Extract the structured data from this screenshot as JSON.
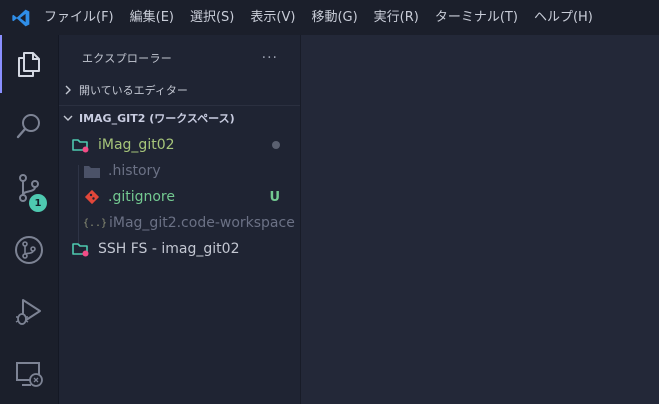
{
  "menu": {
    "logo_icon": "vscode-logo-icon",
    "items": [
      "ファイル(F)",
      "編集(E)",
      "選択(S)",
      "表示(V)",
      "移動(G)",
      "実行(R)",
      "ターミナル(T)",
      "ヘルプ(H)"
    ]
  },
  "activity": {
    "icons": [
      "explorer-icon",
      "search-icon",
      "source-control-icon",
      "git-graph-icon",
      "run-debug-icon",
      "remote-explorer-icon"
    ],
    "scm_badge": "1"
  },
  "sidebar": {
    "title": "エクスプローラー",
    "more": "···",
    "open_editors": "開いているエディター",
    "workspace": "IMAG_GIT2 (ワークスペース)",
    "items": [
      {
        "label": "iMag_git02",
        "color": "#a6c57a",
        "icon": "remote-folder-icon"
      },
      {
        "label": ".history",
        "color": "#6b7185",
        "icon": "folder-icon"
      },
      {
        "label": ".gitignore",
        "color": "#73c991",
        "icon": "git-file-icon",
        "badge": "U"
      },
      {
        "label": "iMag_git2.code-workspace",
        "color": "#6b7185",
        "icon": "json-braces-icon"
      },
      {
        "label": "SSH FS - imag_git02",
        "color": "#c3c7d2",
        "icon": "remote-folder-icon"
      }
    ]
  },
  "colors": {
    "accent": "#8a8fff",
    "badge": "#4ec9b0",
    "untracked": "#73c991",
    "modified_folder": "#a6c57a"
  }
}
